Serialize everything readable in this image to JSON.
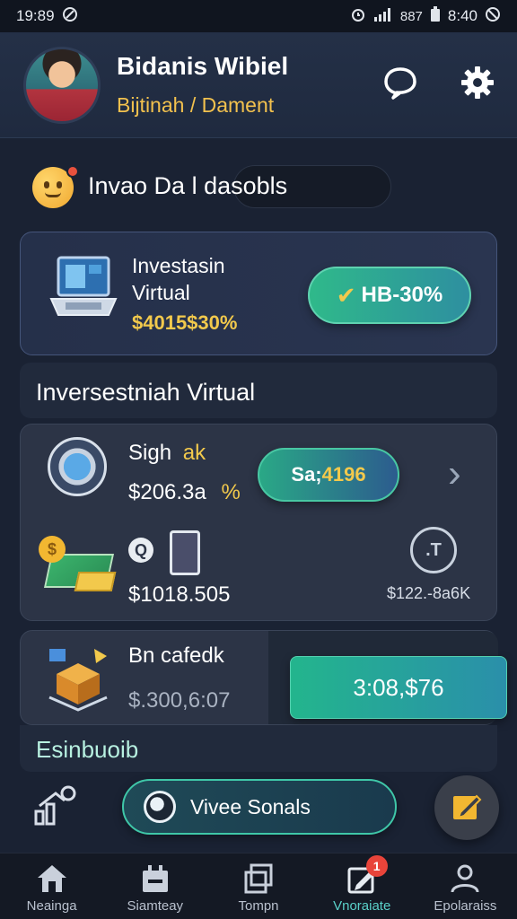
{
  "status_bar": {
    "time": "19:89",
    "battery_time": "8:40",
    "net": "887"
  },
  "header": {
    "user_name": "Bidanis Wibiel",
    "subtitle": "Bijtinah / Dament"
  },
  "greeting": {
    "text": "Invao Da l dasobls"
  },
  "invest_card": {
    "title": "Investasin Virtual",
    "amount": "$4015$30%",
    "button_label": "HB-30%"
  },
  "section_title": "Inversestniah Virtual",
  "list_card": {
    "row1": {
      "title": "Sigh",
      "tag": "ak",
      "amount": "$206.3a",
      "percent": "%",
      "pill_prefix": "Sa;",
      "pill_value": "4196"
    },
    "row2": {
      "amount": "$1018.505",
      "stat_value": "$122.-8a6K",
      "magnify_glyph": "Q",
      "stat_glyph": ".T"
    }
  },
  "box_card": {
    "title": "Bn cafedk",
    "amount": "$.300,6:07",
    "value": "3:08,$76"
  },
  "section2_title": "Esinbuoib",
  "visit_button": {
    "label": "Vivee Sonals"
  },
  "nav": {
    "items": [
      {
        "label": "Neainga"
      },
      {
        "label": "Siamteay"
      },
      {
        "label": "Tompn"
      },
      {
        "label": "Vnoraiate",
        "badge": "1"
      },
      {
        "label": "Epolaraiss"
      }
    ]
  },
  "colors": {
    "accent_gold": "#f2c94c",
    "accent_teal": "#2fb98a",
    "bg": "#1a2233"
  }
}
